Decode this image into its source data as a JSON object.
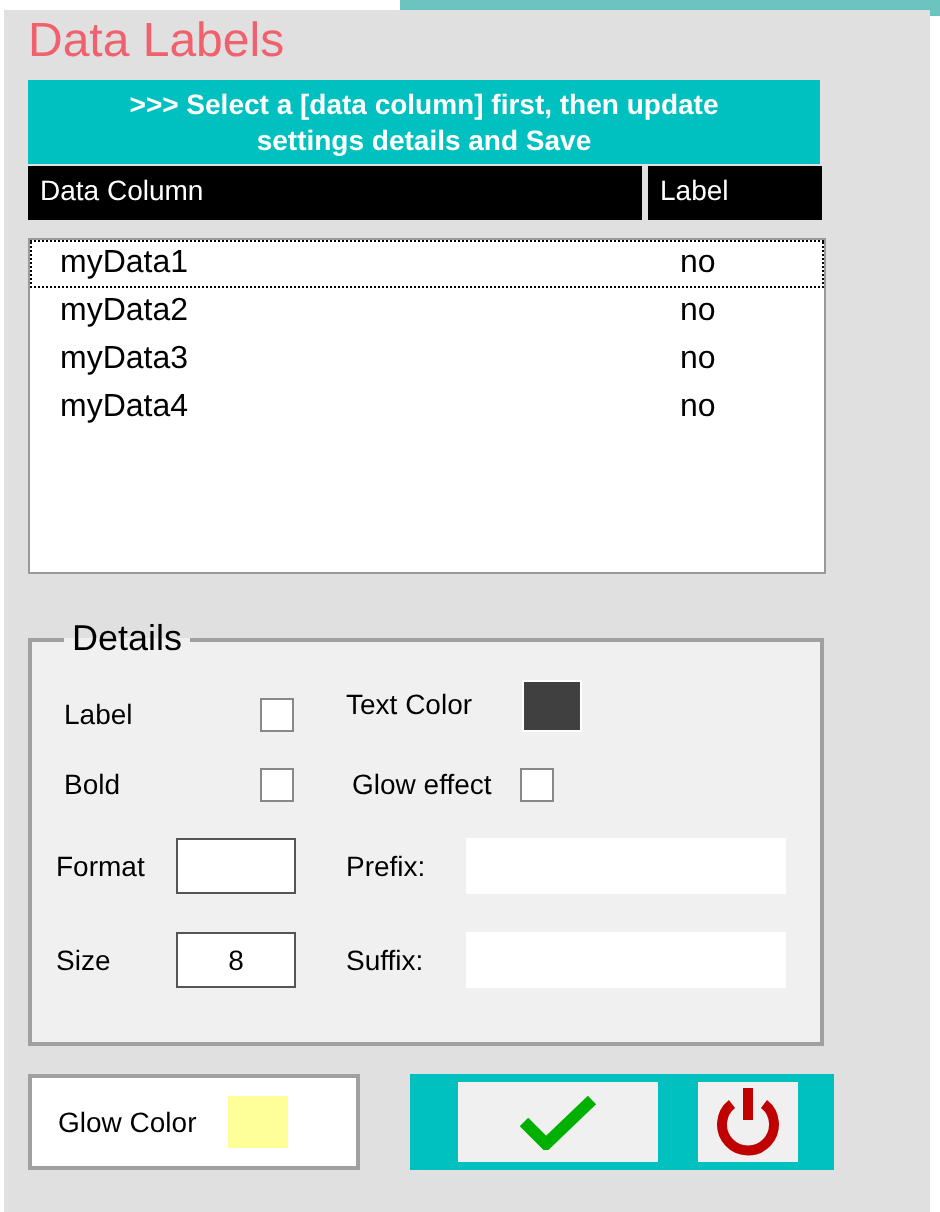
{
  "title": "Data Labels",
  "banner": ">>> Select a [data column] first, then update settings details and Save",
  "columns": [
    "Data Column",
    "Label"
  ],
  "rows": [
    {
      "name": "myData1",
      "label": "no",
      "selected": true
    },
    {
      "name": "myData2",
      "label": "no",
      "selected": false
    },
    {
      "name": "myData3",
      "label": "no",
      "selected": false
    },
    {
      "name": "myData4",
      "label": "no",
      "selected": false
    }
  ],
  "details": {
    "legend": "Details",
    "label_check": {
      "text": "Label",
      "checked": false
    },
    "bold_check": {
      "text": "Bold",
      "checked": false
    },
    "text_color": {
      "text": "Text Color",
      "color": "#404040"
    },
    "glow_check": {
      "text": "Glow effect",
      "checked": false
    },
    "format": {
      "text": "Format"
    },
    "size": {
      "text": "Size",
      "value": "8"
    },
    "prefix": {
      "text": "Prefix:"
    },
    "suffix": {
      "text": "Suffix:"
    }
  },
  "glow_color": {
    "text": "Glow Color",
    "color": "#ffff99"
  }
}
